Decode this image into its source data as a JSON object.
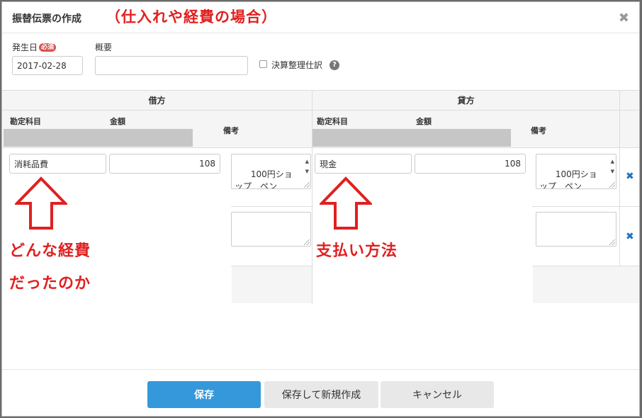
{
  "dialog": {
    "title": "振替伝票の作成",
    "annotation_title": "（仕入れや経費の場合）",
    "close_glyph": "✖"
  },
  "form": {
    "date_label": "発生日",
    "required_badge": "必須",
    "date_value": "2017-02-28",
    "summary_label": "概要",
    "summary_value": "",
    "closing_entry_label": "決算整理仕訳",
    "help_glyph": "?"
  },
  "debit": {
    "header": "借方",
    "account_label": "勘定科目",
    "amount_label": "金額",
    "memo_label": "備考",
    "rows": [
      {
        "account": "消耗品費",
        "amount": "108",
        "memo": "100円ショップ　ペン"
      },
      {
        "account": "",
        "amount": "",
        "memo": ""
      }
    ]
  },
  "credit": {
    "header": "貸方",
    "account_label": "勘定科目",
    "amount_label": "金額",
    "memo_label": "備考",
    "rows": [
      {
        "account": "現金",
        "amount": "108",
        "memo": "100円ショップ　ペン"
      },
      {
        "account": "",
        "amount": "",
        "memo": ""
      }
    ]
  },
  "annotations": {
    "debit_line1": "どんな経費",
    "debit_line2": "だったのか",
    "credit_line1": "支払い方法",
    "color": "#e02020"
  },
  "footer": {
    "save_label": "保存",
    "save_new_label": "保存して新規作成",
    "cancel_label": "キャンセル"
  },
  "colors": {
    "primary": "#3498db",
    "delete": "#1a73c8"
  }
}
